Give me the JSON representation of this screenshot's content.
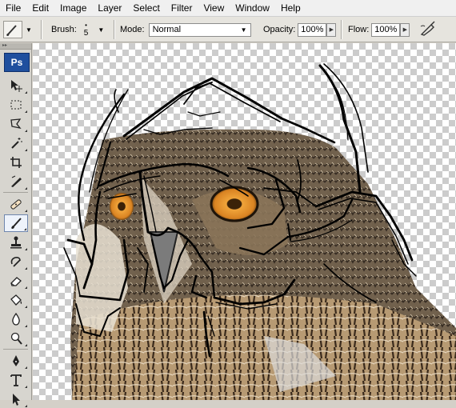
{
  "menubar": {
    "items": [
      "File",
      "Edit",
      "Image",
      "Layer",
      "Select",
      "Filter",
      "View",
      "Window",
      "Help"
    ]
  },
  "options_bar": {
    "tool_icon": "brush-icon",
    "brush_label": "Brush:",
    "brush_size": "5",
    "mode_label": "Mode:",
    "mode_value": "Normal",
    "opacity_label": "Opacity:",
    "opacity_value": "100%",
    "flow_label": "Flow:",
    "flow_value": "100%",
    "airbrush_icon": "airbrush-icon"
  },
  "toolbox": {
    "logo": "Ps",
    "active_tool": "brush-tool",
    "tools": [
      "move-tool",
      "marquee-tool",
      "lasso-tool",
      "magic-wand-tool",
      "crop-tool",
      "slice-tool",
      "healing-brush-tool",
      "brush-tool",
      "clone-stamp-tool",
      "history-brush-tool",
      "eraser-tool",
      "paint-bucket-tool",
      "blur-tool",
      "dodge-tool",
      "pen-tool",
      "type-tool",
      "path-selection-tool"
    ]
  },
  "colors": {
    "accent": "#1f4f9e",
    "checker_dark": "#cccccc",
    "checker_light": "#ffffff",
    "sketch_stroke": "#000000",
    "owl_eye": "#e0902a"
  }
}
